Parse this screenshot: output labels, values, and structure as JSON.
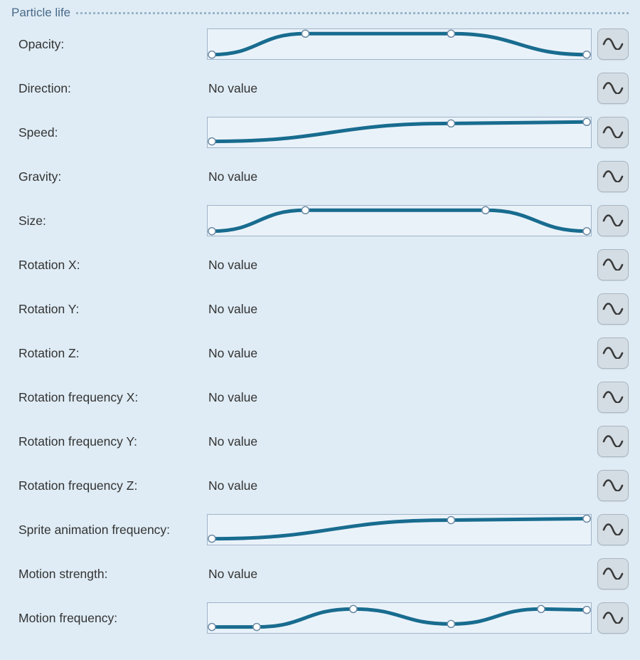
{
  "section": {
    "title": "Particle life"
  },
  "no_value_text": "No value",
  "properties": [
    {
      "id": "opacity",
      "label": "Opacity:",
      "type": "curve",
      "curve": {
        "points": [
          {
            "x": 0.011,
            "y": 0.85
          },
          {
            "x": 0.255,
            "y": 0.15
          },
          {
            "x": 0.635,
            "y": 0.15
          },
          {
            "x": 0.989,
            "y": 0.85
          }
        ],
        "segments": [
          "bezier",
          "line",
          "bezier"
        ]
      }
    },
    {
      "id": "direction",
      "label": "Direction:",
      "type": "none"
    },
    {
      "id": "speed",
      "label": "Speed:",
      "type": "curve",
      "curve": {
        "points": [
          {
            "x": 0.011,
            "y": 0.8
          },
          {
            "x": 0.635,
            "y": 0.2
          },
          {
            "x": 0.989,
            "y": 0.15
          }
        ],
        "segments": [
          "bezier",
          "line"
        ]
      }
    },
    {
      "id": "gravity",
      "label": "Gravity:",
      "type": "none"
    },
    {
      "id": "size",
      "label": "Size:",
      "type": "curve",
      "curve": {
        "points": [
          {
            "x": 0.011,
            "y": 0.85
          },
          {
            "x": 0.255,
            "y": 0.15
          },
          {
            "x": 0.725,
            "y": 0.15
          },
          {
            "x": 0.989,
            "y": 0.85
          }
        ],
        "segments": [
          "bezier",
          "line",
          "bezier"
        ]
      }
    },
    {
      "id": "rotation-x",
      "label": "Rotation X:",
      "type": "none"
    },
    {
      "id": "rotation-y",
      "label": "Rotation Y:",
      "type": "none"
    },
    {
      "id": "rotation-z",
      "label": "Rotation Z:",
      "type": "none"
    },
    {
      "id": "rotation-frequency-x",
      "label": "Rotation frequency X:",
      "type": "none"
    },
    {
      "id": "rotation-frequency-y",
      "label": "Rotation frequency Y:",
      "type": "none"
    },
    {
      "id": "rotation-frequency-z",
      "label": "Rotation frequency Z:",
      "type": "none"
    },
    {
      "id": "sprite-animation-frequency",
      "label": "Sprite animation frequency:",
      "type": "curve",
      "curve": {
        "points": [
          {
            "x": 0.011,
            "y": 0.8
          },
          {
            "x": 0.635,
            "y": 0.18
          },
          {
            "x": 0.989,
            "y": 0.13
          }
        ],
        "segments": [
          "bezier",
          "line"
        ]
      }
    },
    {
      "id": "motion-strength",
      "label": "Motion strength:",
      "type": "none"
    },
    {
      "id": "motion-frequency",
      "label": "Motion frequency:",
      "type": "curve",
      "curve": {
        "points": [
          {
            "x": 0.011,
            "y": 0.8
          },
          {
            "x": 0.128,
            "y": 0.8
          },
          {
            "x": 0.38,
            "y": 0.2
          },
          {
            "x": 0.635,
            "y": 0.7
          },
          {
            "x": 0.87,
            "y": 0.2
          },
          {
            "x": 0.989,
            "y": 0.23
          }
        ],
        "segments": [
          "line",
          "bezier",
          "bezier",
          "bezier",
          "line"
        ]
      }
    }
  ]
}
